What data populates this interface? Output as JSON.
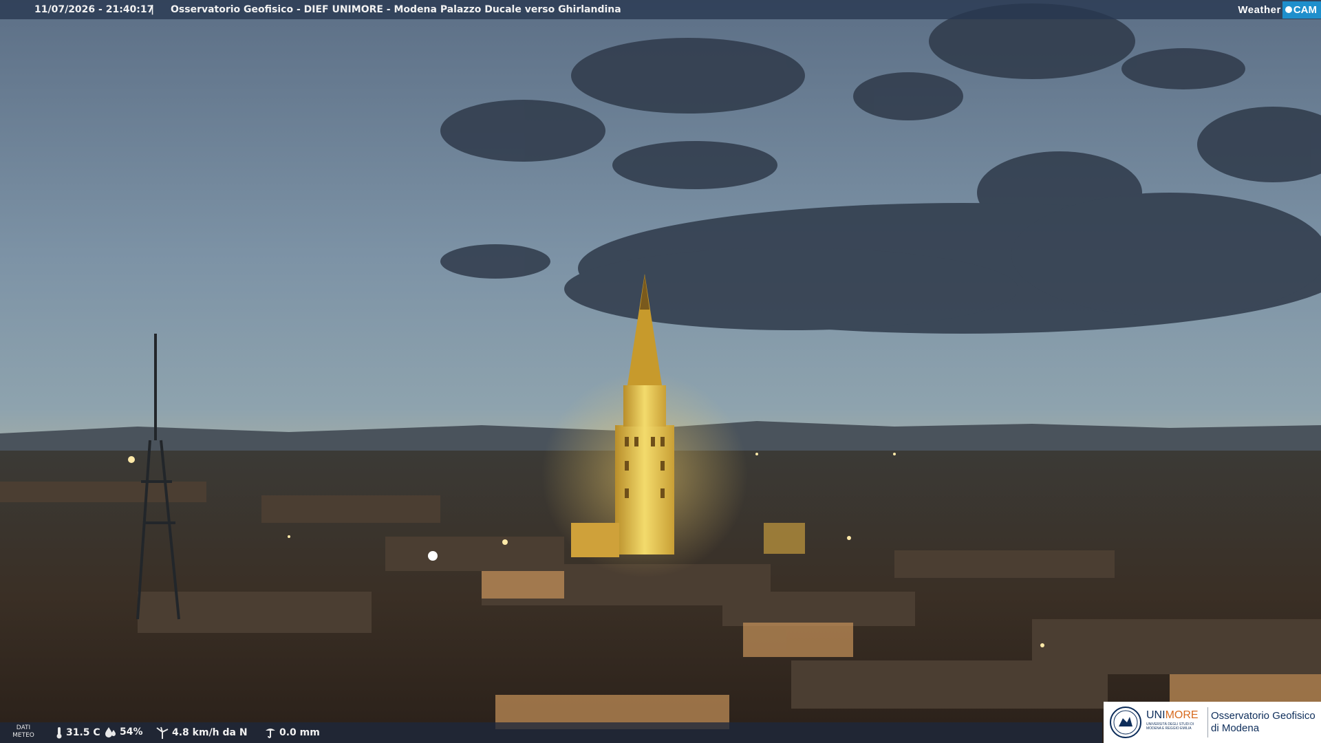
{
  "header": {
    "timestamp": "11/07/2026 - 21:40:17",
    "separator": "|",
    "title": "Osservatorio Geofisico - DIEF UNIMORE - Modena Palazzo Ducale verso Ghirlandina",
    "brand_weather": "Weather",
    "brand_cam": "CAM"
  },
  "weather": {
    "dati_line1": "DATI",
    "dati_line2": "METEO",
    "temperature": "31.5 C",
    "humidity": "54%",
    "wind": "4.8 km/h da N",
    "rain": "0.0 mm"
  },
  "logo": {
    "uni_a": "UNI",
    "uni_b": "MORE",
    "uni_sub": "UNIVERSITÀ DEGLI STUDI DI MODENA E REGGIO EMILIA",
    "obs_line1": "Osservatorio Geofisico",
    "obs_line2": "di Modena"
  },
  "colors": {
    "bar": "#28374f",
    "brand_blue": "#1f8fcc",
    "logo_navy": "#0d2d5a",
    "logo_orange": "#d76a1e",
    "tower_light": "#e7c24a"
  },
  "icons": [
    "thermometer-icon",
    "humidity-icon",
    "wind-icon",
    "rain-gauge-icon",
    "university-seal-icon"
  ]
}
